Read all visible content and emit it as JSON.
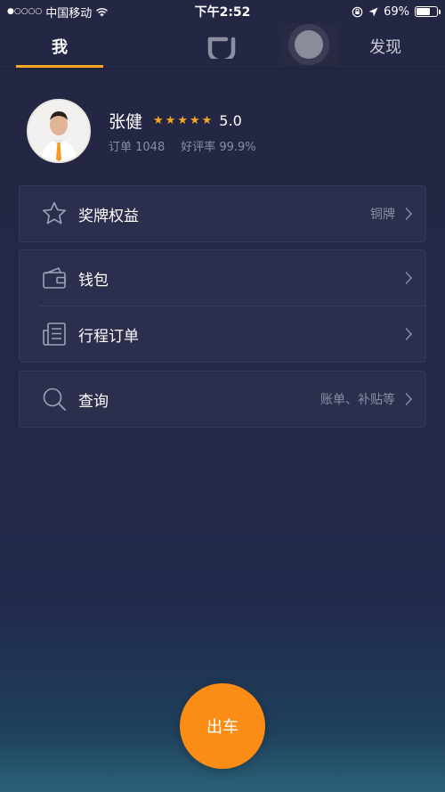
{
  "status_bar": {
    "signal_dots": "●○○○○",
    "carrier": "中国移动",
    "time": "下午2:52",
    "battery_percent": "69%",
    "battery_level": 0.69
  },
  "nav": {
    "tab_me": "我",
    "tab_discover": "发现"
  },
  "profile": {
    "name": "张健",
    "stars": 5,
    "rating": "5.0",
    "orders": "订单 1048",
    "positive_rate": "好评率 99.9%"
  },
  "menu": {
    "medal": {
      "label": "奖牌权益",
      "value": "铜牌"
    },
    "wallet": {
      "label": "钱包"
    },
    "trips": {
      "label": "行程订单"
    },
    "query": {
      "label": "查询",
      "value": "账单、补贴等"
    }
  },
  "go_button": {
    "label": "出车"
  },
  "colors": {
    "accent": "#f5a623",
    "go_button": "#fb8c16",
    "card_bg": "#2b2e4c",
    "page_bg": "#242744"
  }
}
